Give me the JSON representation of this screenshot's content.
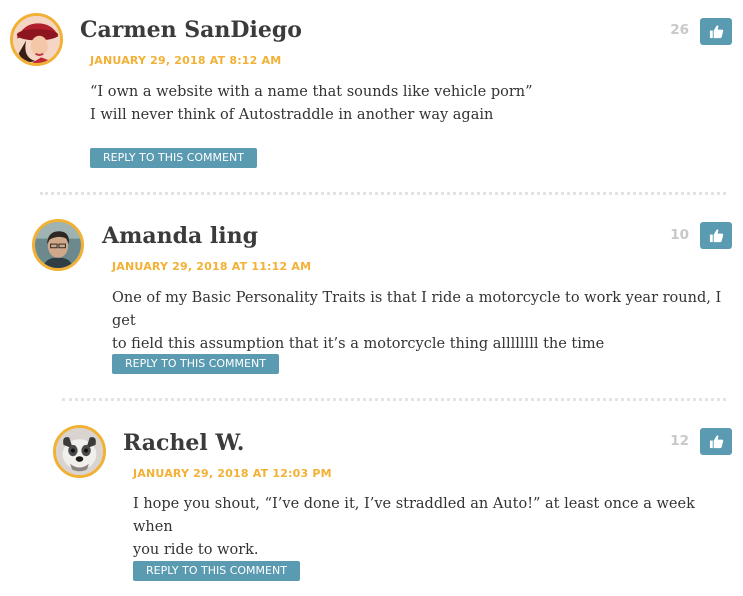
{
  "colors": {
    "accent": "#5b9bb2",
    "date": "#f2b134",
    "avatar_border": "#f2b134",
    "author": "#3b3b3b",
    "likes": "#c8c8c8"
  },
  "comments": [
    {
      "author": "Carmen SanDiego",
      "date": "JANUARY 29, 2018 AT 8:12 AM",
      "lines": [
        "“I own a website with a name that sounds like vehicle porn”",
        "I will never think of Autostraddle in another way again"
      ],
      "reply_label": "REPLY TO THIS COMMENT",
      "likes": "26",
      "like_icon": "thumbs-up-icon"
    },
    {
      "author": "Amanda ling",
      "date": "JANUARY 29, 2018 AT 11:12 AM",
      "lines": [
        "One of my Basic Personality Traits is that I ride a motorcycle to work year round, I get",
        "to field this assumption that it’s a motorcycle thing allllllll the time"
      ],
      "reply_label": "REPLY TO THIS COMMENT",
      "likes": "10",
      "like_icon": "thumbs-up-icon"
    },
    {
      "author": "Rachel W.",
      "date": "JANUARY 29, 2018 AT 12:03 PM",
      "lines": [
        "I hope you shout, “I’ve done it, I’ve straddled an Auto!” at least once a week when",
        "you ride to work."
      ],
      "reply_label": "REPLY TO THIS COMMENT",
      "likes": "12",
      "like_icon": "thumbs-up-icon"
    }
  ]
}
